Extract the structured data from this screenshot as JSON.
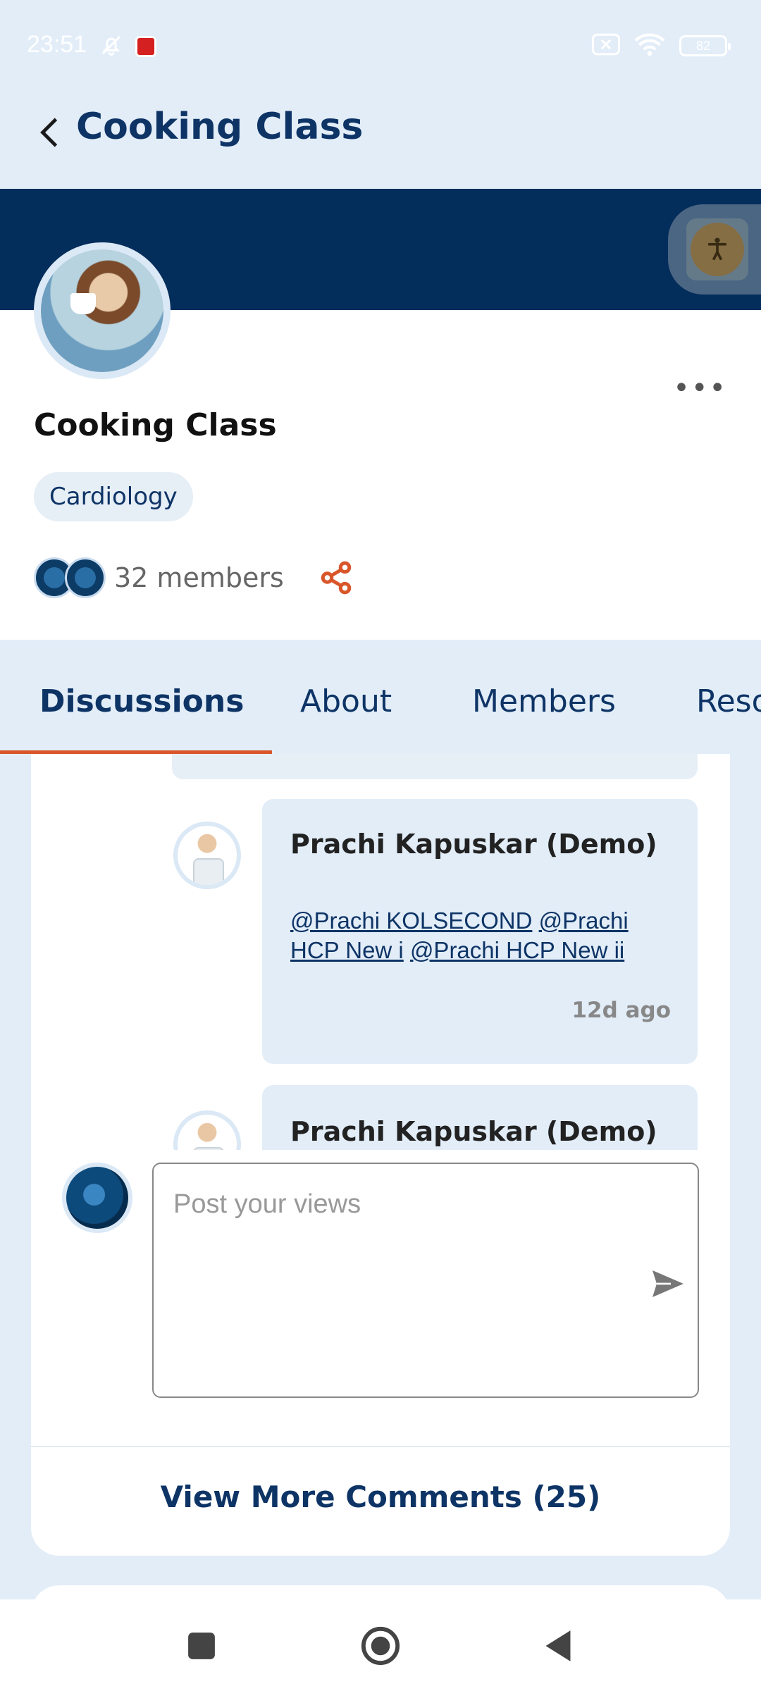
{
  "status_bar": {
    "time": "23:51",
    "battery": "82"
  },
  "header": {
    "title": "Cooking Class"
  },
  "group": {
    "name": "Cooking Class",
    "tag": "Cardiology",
    "members_label": "32 members"
  },
  "tabs": [
    {
      "label": "Discussions",
      "active": true
    },
    {
      "label": "About",
      "active": false
    },
    {
      "label": "Members",
      "active": false
    },
    {
      "label": "Resources",
      "active": false
    }
  ],
  "comments": [
    {
      "author": "Prachi Kapuskar (Demo)",
      "mentions": [
        "@Prachi KOLSECOND",
        "@Prachi HCP New i",
        "@Prachi HCP New ii"
      ],
      "time": "12d ago"
    },
    {
      "author": "Prachi Kapuskar (Demo)"
    }
  ],
  "composer": {
    "placeholder": "Post your views"
  },
  "view_more_label": "View More Comments (25)",
  "colors": {
    "primary": "#0e3466",
    "banner": "#032d5b",
    "accent": "#d9562a",
    "page_bg": "#e2edf8"
  }
}
